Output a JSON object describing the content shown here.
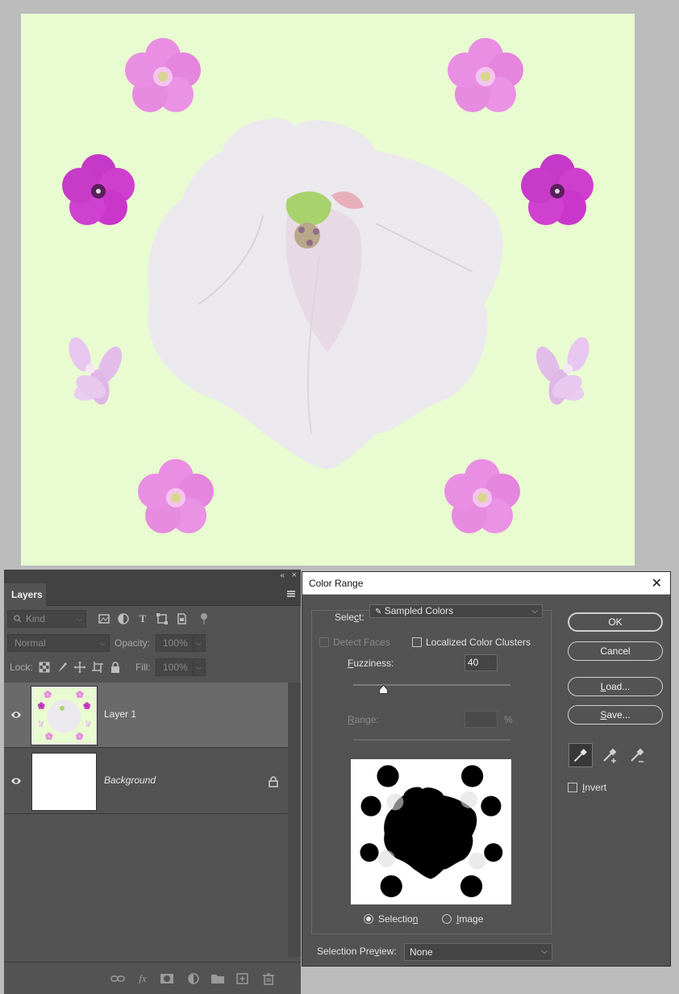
{
  "colors": {
    "canvas_bg": "#e9fbd0",
    "panel_bg": "#535353",
    "selected_layer_bg": "#6a6a6a"
  },
  "layers_panel": {
    "tab_label": "Layers",
    "kind_filter": "Kind",
    "blend_mode": "Normal",
    "opacity_label": "Opacity:",
    "opacity_value": "100%",
    "lock_label": "Lock:",
    "fill_label": "Fill:",
    "fill_value": "100%",
    "layers": [
      {
        "name": "Layer 1",
        "visible": true,
        "selected": true,
        "locked": false
      },
      {
        "name": "Background",
        "visible": true,
        "selected": false,
        "locked": true
      }
    ],
    "bottom_icons": [
      "link-icon",
      "fx-icon",
      "mask-icon",
      "adjustment-icon",
      "folder-icon",
      "new-layer-icon",
      "trash-icon"
    ]
  },
  "color_range": {
    "title": "Color Range",
    "select_label_pre": "Sele",
    "select_label_u": "c",
    "select_label_post": "t:",
    "select_value": "Sampled Colors",
    "detect_faces": "Detect Faces",
    "localized_color_clusters": "Localized Color Clusters",
    "fuzziness_label_u": "F",
    "fuzziness_label_post": "uzziness:",
    "fuzziness_value": "40",
    "fuzziness_fraction": 0.19,
    "range_label_u": "R",
    "range_label_post": "ange:",
    "range_unit": "%",
    "selection_label_pre": "Selectio",
    "selection_label_u": "n",
    "image_label_u": "I",
    "image_label_post": "mage",
    "selection_preview_label_pre": "Selection Pre",
    "selection_preview_label_u": "v",
    "selection_preview_label_post": "iew:",
    "selection_preview_value": "None",
    "buttons": {
      "ok": "OK",
      "cancel": "Cancel",
      "load_u": "L",
      "load_post": "oad...",
      "save_u": "S",
      "save_post": "ave..."
    },
    "invert_u": "I",
    "invert_post": "nvert"
  }
}
